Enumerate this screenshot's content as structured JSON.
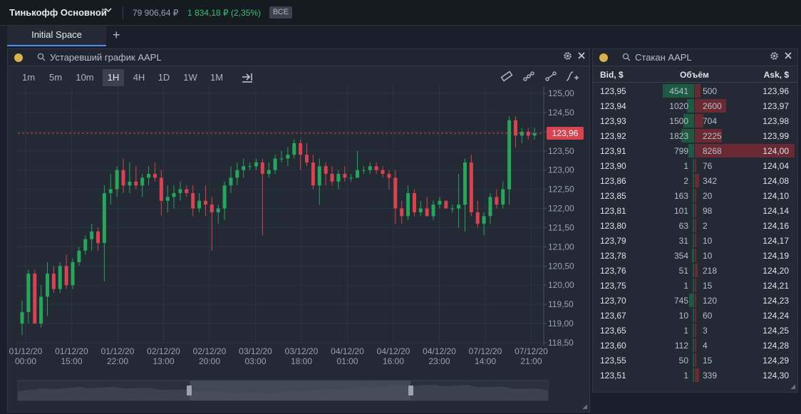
{
  "topbar": {
    "account": "Тинькофф Основной",
    "balance": "79 906,64 ₽",
    "change": "1 834,18 ₽ (2,35%)",
    "filter_badge": "ВСЕ"
  },
  "tabs": {
    "active_label": "Initial Space",
    "add_label": "+"
  },
  "chart_panel": {
    "title": "Устаревший график AAPL",
    "timeframes": [
      "1m",
      "5m",
      "10m",
      "1H",
      "4H",
      "1D",
      "1W",
      "1M"
    ],
    "active_timeframe": "1H",
    "current_price_label": "123,96",
    "colors": {
      "up": "#26a65b",
      "down": "#d9434f",
      "price_line": "#d9434f"
    }
  },
  "chart_data": {
    "type": "candlestick",
    "ylim": [
      118.5,
      125.0
    ],
    "y_ticks": [
      "125,00",
      "124,50",
      "124,00",
      "123,50",
      "123,00",
      "122,50",
      "122,00",
      "121,50",
      "121,00",
      "120,50",
      "120,00",
      "119,50",
      "119,00",
      "118,50"
    ],
    "x_ticks": [
      {
        "date": "01/12/20",
        "time": "00:00"
      },
      {
        "date": "01/12/20",
        "time": "15:00"
      },
      {
        "date": "01/12/20",
        "time": "22:00"
      },
      {
        "date": "02/12/20",
        "time": "13:00"
      },
      {
        "date": "02/12/20",
        "time": "20:00"
      },
      {
        "date": "03/12/20",
        "time": "03:00"
      },
      {
        "date": "03/12/20",
        "time": "18:00"
      },
      {
        "date": "04/12/20",
        "time": "01:00"
      },
      {
        "date": "04/12/20",
        "time": "16:00"
      },
      {
        "date": "04/12/20",
        "time": "23:00"
      },
      {
        "date": "07/12/20",
        "time": "14:00"
      },
      {
        "date": "07/12/20",
        "time": "21:00"
      }
    ],
    "current_price": 123.96,
    "candles": [
      {
        "o": 119.0,
        "h": 119.6,
        "l": 118.7,
        "c": 119.3
      },
      {
        "o": 119.3,
        "h": 120.4,
        "l": 119.0,
        "c": 120.3
      },
      {
        "o": 120.3,
        "h": 120.4,
        "l": 119.0,
        "c": 119.0
      },
      {
        "o": 119.0,
        "h": 120.0,
        "l": 118.9,
        "c": 119.7
      },
      {
        "o": 119.7,
        "h": 120.6,
        "l": 119.2,
        "c": 120.3
      },
      {
        "o": 120.3,
        "h": 120.5,
        "l": 119.8,
        "c": 119.9
      },
      {
        "o": 119.9,
        "h": 120.6,
        "l": 119.8,
        "c": 120.5
      },
      {
        "o": 120.5,
        "h": 120.8,
        "l": 119.9,
        "c": 120.0
      },
      {
        "o": 120.0,
        "h": 120.7,
        "l": 119.9,
        "c": 120.6
      },
      {
        "o": 120.6,
        "h": 121.0,
        "l": 120.5,
        "c": 120.9
      },
      {
        "o": 120.9,
        "h": 121.3,
        "l": 120.8,
        "c": 121.2
      },
      {
        "o": 121.2,
        "h": 121.6,
        "l": 120.9,
        "c": 121.4
      },
      {
        "o": 121.4,
        "h": 121.5,
        "l": 120.9,
        "c": 121.1
      },
      {
        "o": 121.1,
        "h": 122.6,
        "l": 120.1,
        "c": 122.4
      },
      {
        "o": 122.4,
        "h": 122.9,
        "l": 122.1,
        "c": 122.5
      },
      {
        "o": 122.5,
        "h": 123.1,
        "l": 122.3,
        "c": 123.0
      },
      {
        "o": 123.0,
        "h": 123.3,
        "l": 122.4,
        "c": 122.6
      },
      {
        "o": 122.6,
        "h": 123.2,
        "l": 122.4,
        "c": 122.7
      },
      {
        "o": 122.7,
        "h": 123.1,
        "l": 122.5,
        "c": 122.6
      },
      {
        "o": 122.6,
        "h": 122.9,
        "l": 122.3,
        "c": 122.8
      },
      {
        "o": 122.8,
        "h": 123.1,
        "l": 122.6,
        "c": 122.9
      },
      {
        "o": 122.9,
        "h": 123.2,
        "l": 122.7,
        "c": 122.8
      },
      {
        "o": 122.8,
        "h": 123.0,
        "l": 121.8,
        "c": 122.2
      },
      {
        "o": 122.2,
        "h": 122.6,
        "l": 121.9,
        "c": 122.3
      },
      {
        "o": 122.3,
        "h": 122.6,
        "l": 122.0,
        "c": 122.4
      },
      {
        "o": 122.4,
        "h": 122.7,
        "l": 122.2,
        "c": 122.5
      },
      {
        "o": 122.5,
        "h": 122.6,
        "l": 122.3,
        "c": 122.4
      },
      {
        "o": 122.4,
        "h": 122.6,
        "l": 121.8,
        "c": 122.0
      },
      {
        "o": 122.0,
        "h": 122.4,
        "l": 121.9,
        "c": 122.2
      },
      {
        "o": 122.2,
        "h": 122.6,
        "l": 121.8,
        "c": 122.1
      },
      {
        "o": 122.1,
        "h": 122.3,
        "l": 120.9,
        "c": 121.9
      },
      {
        "o": 121.9,
        "h": 122.1,
        "l": 121.6,
        "c": 122.0
      },
      {
        "o": 122.0,
        "h": 122.7,
        "l": 121.7,
        "c": 122.6
      },
      {
        "o": 122.6,
        "h": 123.1,
        "l": 122.4,
        "c": 122.8
      },
      {
        "o": 122.8,
        "h": 123.2,
        "l": 122.6,
        "c": 123.0
      },
      {
        "o": 123.0,
        "h": 123.3,
        "l": 122.8,
        "c": 123.1
      },
      {
        "o": 123.1,
        "h": 123.2,
        "l": 123.0,
        "c": 123.1
      },
      {
        "o": 123.1,
        "h": 123.3,
        "l": 123.0,
        "c": 123.2
      },
      {
        "o": 123.2,
        "h": 123.3,
        "l": 121.3,
        "c": 122.9
      },
      {
        "o": 122.9,
        "h": 123.2,
        "l": 122.8,
        "c": 123.0
      },
      {
        "o": 123.0,
        "h": 123.4,
        "l": 122.9,
        "c": 123.3
      },
      {
        "o": 123.3,
        "h": 123.5,
        "l": 123.2,
        "c": 123.3
      },
      {
        "o": 123.3,
        "h": 123.6,
        "l": 123.1,
        "c": 123.4
      },
      {
        "o": 123.4,
        "h": 123.8,
        "l": 123.3,
        "c": 123.7
      },
      {
        "o": 123.7,
        "h": 123.8,
        "l": 123.0,
        "c": 123.4
      },
      {
        "o": 123.4,
        "h": 123.7,
        "l": 123.1,
        "c": 123.2
      },
      {
        "o": 123.2,
        "h": 123.4,
        "l": 122.5,
        "c": 122.6
      },
      {
        "o": 122.6,
        "h": 123.3,
        "l": 122.1,
        "c": 123.1
      },
      {
        "o": 123.1,
        "h": 123.2,
        "l": 122.6,
        "c": 122.9
      },
      {
        "o": 122.9,
        "h": 123.1,
        "l": 122.6,
        "c": 122.7
      },
      {
        "o": 122.7,
        "h": 123.0,
        "l": 122.5,
        "c": 122.9
      },
      {
        "o": 122.9,
        "h": 123.1,
        "l": 122.7,
        "c": 122.8
      },
      {
        "o": 122.8,
        "h": 122.9,
        "l": 122.7,
        "c": 122.8
      },
      {
        "o": 122.8,
        "h": 123.5,
        "l": 122.8,
        "c": 123.0
      },
      {
        "o": 123.0,
        "h": 123.1,
        "l": 122.9,
        "c": 123.0
      },
      {
        "o": 123.0,
        "h": 123.2,
        "l": 122.9,
        "c": 123.1
      },
      {
        "o": 123.1,
        "h": 123.2,
        "l": 122.9,
        "c": 123.0
      },
      {
        "o": 123.0,
        "h": 123.1,
        "l": 122.8,
        "c": 122.9
      },
      {
        "o": 122.9,
        "h": 123.0,
        "l": 122.5,
        "c": 122.8
      },
      {
        "o": 122.8,
        "h": 123.0,
        "l": 121.6,
        "c": 122.0
      },
      {
        "o": 122.0,
        "h": 122.2,
        "l": 121.6,
        "c": 121.8
      },
      {
        "o": 121.8,
        "h": 122.6,
        "l": 121.7,
        "c": 122.4
      },
      {
        "o": 122.4,
        "h": 122.5,
        "l": 121.8,
        "c": 121.9
      },
      {
        "o": 121.9,
        "h": 122.2,
        "l": 121.8,
        "c": 122.0
      },
      {
        "o": 122.0,
        "h": 122.3,
        "l": 121.8,
        "c": 121.8
      },
      {
        "o": 121.8,
        "h": 122.2,
        "l": 121.7,
        "c": 122.1
      },
      {
        "o": 122.1,
        "h": 122.3,
        "l": 122.0,
        "c": 122.2
      },
      {
        "o": 122.2,
        "h": 122.2,
        "l": 122.0,
        "c": 122.0
      },
      {
        "o": 122.0,
        "h": 122.1,
        "l": 121.9,
        "c": 122.0
      },
      {
        "o": 122.0,
        "h": 122.9,
        "l": 121.5,
        "c": 122.1
      },
      {
        "o": 122.1,
        "h": 123.3,
        "l": 121.4,
        "c": 123.2
      },
      {
        "o": 123.2,
        "h": 123.4,
        "l": 121.8,
        "c": 121.9
      },
      {
        "o": 121.9,
        "h": 122.2,
        "l": 121.5,
        "c": 121.6
      },
      {
        "o": 121.6,
        "h": 121.9,
        "l": 121.3,
        "c": 121.8
      },
      {
        "o": 121.8,
        "h": 122.4,
        "l": 121.6,
        "c": 122.3
      },
      {
        "o": 122.3,
        "h": 122.5,
        "l": 122.0,
        "c": 122.1
      },
      {
        "o": 122.1,
        "h": 122.7,
        "l": 122.0,
        "c": 122.5
      },
      {
        "o": 122.5,
        "h": 124.4,
        "l": 122.1,
        "c": 124.3
      },
      {
        "o": 124.3,
        "h": 124.4,
        "l": 123.6,
        "c": 123.9
      },
      {
        "o": 123.9,
        "h": 124.1,
        "l": 123.7,
        "c": 124.0
      },
      {
        "o": 124.0,
        "h": 124.1,
        "l": 123.8,
        "c": 123.9
      },
      {
        "o": 123.9,
        "h": 124.1,
        "l": 123.8,
        "c": 123.96
      }
    ]
  },
  "order_book": {
    "title": "Стакан AAPL",
    "headers": {
      "bid": "Bid, $",
      "volume": "Объём",
      "ask": "Ask, $"
    },
    "rows": [
      {
        "bid": "123,95",
        "bid_vol": "4541",
        "ask_vol": "500",
        "ask": "123,96",
        "bid_n": 4541,
        "ask_n": 500
      },
      {
        "bid": "123,94",
        "bid_vol": "1020",
        "ask_vol": "2600",
        "ask": "123,97",
        "bid_n": 1020,
        "ask_n": 2600
      },
      {
        "bid": "123,93",
        "bid_vol": "1500",
        "ask_vol": "704",
        "ask": "123,98",
        "bid_n": 1500,
        "ask_n": 704
      },
      {
        "bid": "123,92",
        "bid_vol": "1823",
        "ask_vol": "2225",
        "ask": "123,99",
        "bid_n": 1823,
        "ask_n": 2225
      },
      {
        "bid": "123,91",
        "bid_vol": "799",
        "ask_vol": "8268",
        "ask": "124,00",
        "bid_n": 799,
        "ask_n": 8268
      },
      {
        "bid": "123,90",
        "bid_vol": "1",
        "ask_vol": "76",
        "ask": "124,04",
        "bid_n": 1,
        "ask_n": 76
      },
      {
        "bid": "123,86",
        "bid_vol": "2",
        "ask_vol": "342",
        "ask": "124,08",
        "bid_n": 2,
        "ask_n": 342
      },
      {
        "bid": "123,85",
        "bid_vol": "163",
        "ask_vol": "20",
        "ask": "124,10",
        "bid_n": 163,
        "ask_n": 20
      },
      {
        "bid": "123,81",
        "bid_vol": "101",
        "ask_vol": "98",
        "ask": "124,14",
        "bid_n": 101,
        "ask_n": 98
      },
      {
        "bid": "123,80",
        "bid_vol": "63",
        "ask_vol": "2",
        "ask": "124,16",
        "bid_n": 63,
        "ask_n": 2
      },
      {
        "bid": "123,79",
        "bid_vol": "31",
        "ask_vol": "10",
        "ask": "124,17",
        "bid_n": 31,
        "ask_n": 10
      },
      {
        "bid": "123,78",
        "bid_vol": "354",
        "ask_vol": "10",
        "ask": "124,19",
        "bid_n": 354,
        "ask_n": 10
      },
      {
        "bid": "123,76",
        "bid_vol": "51",
        "ask_vol": "218",
        "ask": "124,20",
        "bid_n": 51,
        "ask_n": 218
      },
      {
        "bid": "123,75",
        "bid_vol": "1",
        "ask_vol": "15",
        "ask": "124,21",
        "bid_n": 1,
        "ask_n": 15
      },
      {
        "bid": "123,70",
        "bid_vol": "745",
        "ask_vol": "120",
        "ask": "124,23",
        "bid_n": 745,
        "ask_n": 120
      },
      {
        "bid": "123,67",
        "bid_vol": "10",
        "ask_vol": "60",
        "ask": "124,24",
        "bid_n": 10,
        "ask_n": 60
      },
      {
        "bid": "123,65",
        "bid_vol": "1",
        "ask_vol": "3",
        "ask": "124,25",
        "bid_n": 1,
        "ask_n": 3
      },
      {
        "bid": "123,60",
        "bid_vol": "112",
        "ask_vol": "4",
        "ask": "124,28",
        "bid_n": 112,
        "ask_n": 4
      },
      {
        "bid": "123,55",
        "bid_vol": "50",
        "ask_vol": "15",
        "ask": "124,29",
        "bid_n": 50,
        "ask_n": 15
      },
      {
        "bid": "123,51",
        "bid_vol": "1",
        "ask_vol": "339",
        "ask": "124,30",
        "bid_n": 1,
        "ask_n": 339
      }
    ]
  }
}
